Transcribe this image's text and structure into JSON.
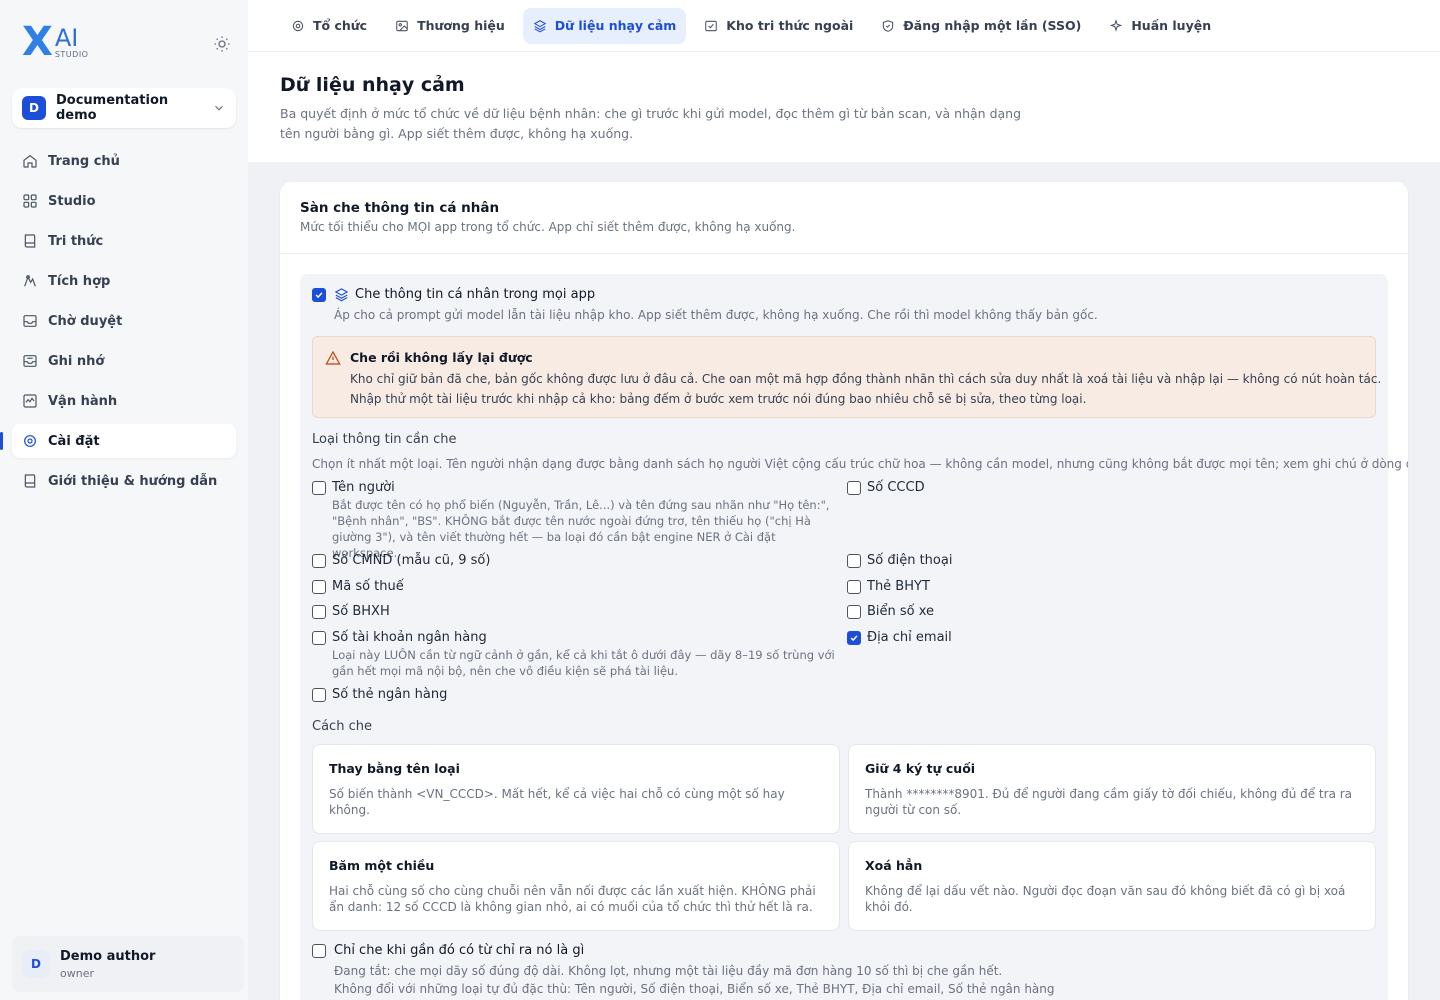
{
  "brand": {
    "mark": "X",
    "name": "AI",
    "sub": "STUDIO"
  },
  "workspace": {
    "avatar": "D",
    "name": "Documentation demo"
  },
  "nav": [
    {
      "label": "Trang chủ",
      "icon": "home-icon"
    },
    {
      "label": "Studio",
      "icon": "grid-icon"
    },
    {
      "label": "Tri thức",
      "icon": "book-icon"
    },
    {
      "label": "Tích hợp",
      "icon": "plug-icon"
    },
    {
      "label": "Chờ duyệt",
      "icon": "inbox-icon"
    },
    {
      "label": "Ghi nhớ",
      "icon": "memory-icon"
    },
    {
      "label": "Vận hành",
      "icon": "activity-icon"
    },
    {
      "label": "Cài đặt",
      "icon": "gear-icon",
      "active": true
    },
    {
      "label": "Giới thiệu & hướng dẫn",
      "icon": "guide-icon"
    }
  ],
  "user": {
    "avatar": "D",
    "name": "Demo author",
    "role": "owner"
  },
  "tabs": [
    {
      "label": "Tổ chức",
      "icon": "org-icon"
    },
    {
      "label": "Thương hiệu",
      "icon": "image-icon"
    },
    {
      "label": "Dữ liệu nhạy cảm",
      "icon": "layers-icon",
      "active": true
    },
    {
      "label": "Kho tri thức ngoài",
      "icon": "external-kb-icon"
    },
    {
      "label": "Đăng nhập một lần (SSO)",
      "icon": "shield-icon"
    },
    {
      "label": "Huấn luyện",
      "icon": "sparkle-icon"
    }
  ],
  "page": {
    "title": "Dữ liệu nhạy cảm",
    "subtitle": "Ba quyết định ở mức tổ chức về dữ liệu bệnh nhân: che gì trước khi gửi model, đọc thêm gì từ bản scan, và nhận dạng tên người bằng gì. App siết thêm được, không hạ xuống."
  },
  "card": {
    "title": "Sàn che thông tin cá nhân",
    "desc": "Mức tối thiểu cho MỌI app trong tổ chức. App chỉ siết thêm được, không hạ xuống."
  },
  "main_option": {
    "label": "Che thông tin cá nhân trong mọi app",
    "checked": true,
    "desc": "Áp cho cả prompt gửi model lẫn tài liệu nhập kho. App siết thêm được, không hạ xuống. Che rồi thì model không thấy bản gốc."
  },
  "warning": {
    "title": "Che rồi không lấy lại được",
    "line1": "Kho chỉ giữ bản đã che, bản gốc không được lưu ở đâu cả. Che oan một mã hợp đồng thành nhãn thì cách sửa duy nhất là xoá tài liệu và nhập lại — không có nút hoàn tác.",
    "line2": "Nhập thử một tài liệu trước khi nhập cả kho: bảng đếm ở bước xem trước nói đúng bao nhiêu chỗ sẽ bị sửa, theo từng loại."
  },
  "types": {
    "label": "Loại thông tin cần che",
    "desc": "Chọn ít nhất một loại. Tên người nhận dạng được bằng danh sách họ người Việt cộng cấu trúc chữ hoa — không cần model, nhưng cũng không bắt được mọi tên; xem ghi chú ở dòng đó.",
    "items": [
      {
        "label": "Tên người",
        "checked": false,
        "note": "Bắt được tên có họ phổ biến (Nguyễn, Trần, Lê...) và tên đứng sau nhãn như \"Họ tên:\", \"Bệnh nhân\", \"BS\". KHÔNG bắt được tên nước ngoài đứng trơ, tên thiếu họ (\"chị Hà giường 3\"), và tên viết thường hết — ba loại đó cần bật engine NER ở Cài đặt workspace."
      },
      {
        "label": "Số CCCD",
        "checked": false
      },
      {
        "label": "Số CMND (mẫu cũ, 9 số)",
        "checked": false
      },
      {
        "label": "Số điện thoại",
        "checked": false
      },
      {
        "label": "Mã số thuế",
        "checked": false
      },
      {
        "label": "Thẻ BHYT",
        "checked": false
      },
      {
        "label": "Số BHXH",
        "checked": false
      },
      {
        "label": "Biển số xe",
        "checked": false
      },
      {
        "label": "Số tài khoản ngân hàng",
        "checked": false,
        "note": "Loại này LUÔN cần từ ngữ cảnh ở gần, kể cả khi tắt ô dưới đây — dãy 8–19 số trùng với gần hết mọi mã nội bộ, nên che vô điều kiện sẽ phá tài liệu."
      },
      {
        "label": "Địa chỉ email",
        "checked": true
      },
      {
        "label": "Số thẻ ngân hàng",
        "checked": false
      }
    ]
  },
  "methods": {
    "label": "Cách che",
    "items": [
      {
        "title": "Thay bằng tên loại",
        "desc": "Số biến thành <VN_CCCD>. Mất hết, kể cả việc hai chỗ có cùng một số hay không."
      },
      {
        "title": "Giữ 4 ký tự cuối",
        "desc": "Thành ********8901. Đủ để người đang cầm giấy tờ đối chiếu, không đủ để tra ra người từ con số."
      },
      {
        "title": "Băm một chiều",
        "desc": "Hai chỗ cùng số cho cùng chuỗi nên vẫn nối được các lần xuất hiện. KHÔNG phải ẩn danh: 12 số CCCD là không gian nhỏ, ai có muối của tổ chức thì thử hết là ra."
      },
      {
        "title": "Xoá hẳn",
        "desc": "Không để lại dấu vết nào. Người đọc đoạn văn sau đó không biết đã có gì bị xoá khỏi đó."
      }
    ]
  },
  "context_option": {
    "label": "Chỉ che khi gần đó có từ chỉ ra nó là gì",
    "checked": false,
    "line1": "Đang tắt: che mọi dãy số đúng độ dài. Không lọt, nhưng một tài liệu đầy mã đơn hàng 10 số thì bị che gần hết.",
    "line2": "Không đổi với những loại tự đủ đặc thù: Tên người, Số điện thoại, Biển số xe, Thẻ BHYT, Địa chỉ email, Số thẻ ngân hàng"
  }
}
